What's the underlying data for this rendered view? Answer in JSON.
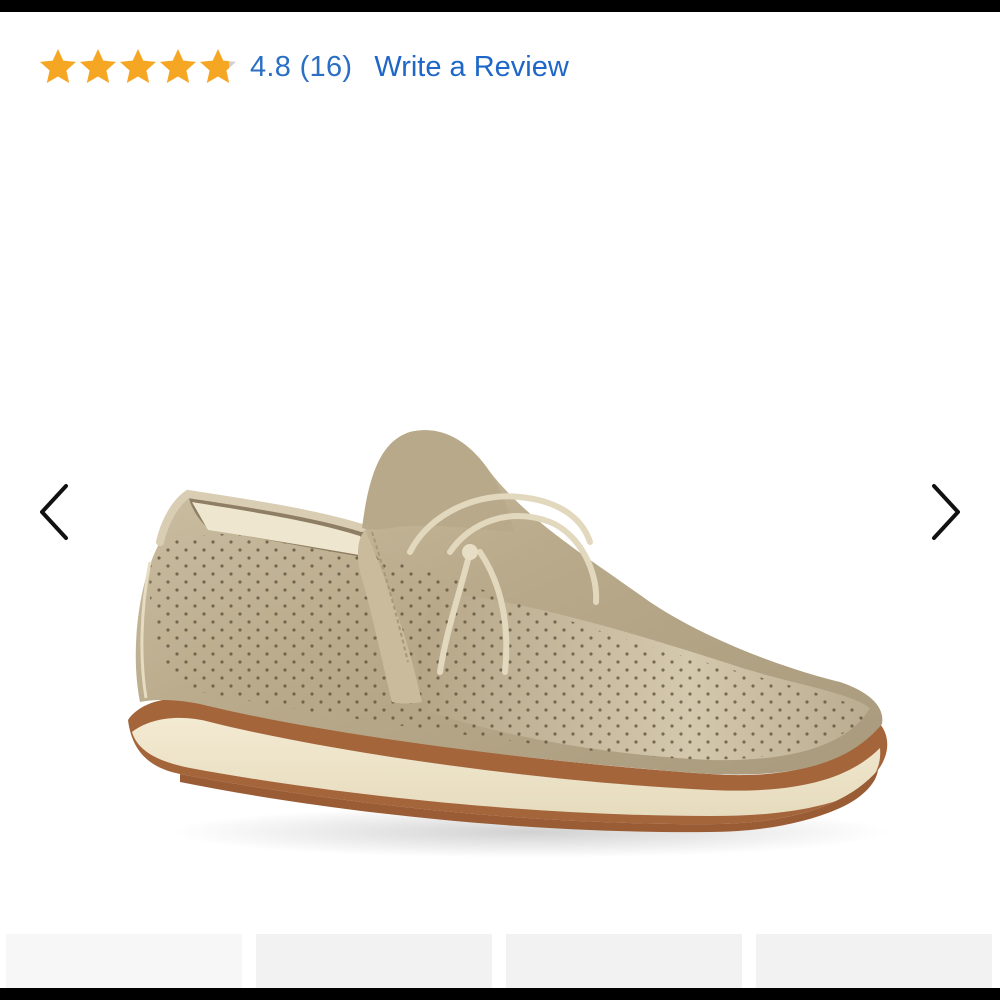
{
  "rating": {
    "value": 4.8,
    "value_text": "4.8 (16)",
    "stars_filled": 4.8,
    "stars_max": 5,
    "star_color": "#f5a623",
    "star_empty_color": "#d0d0d0",
    "link_color": "#1e66c8"
  },
  "review_link": {
    "label": "Write a Review"
  },
  "carousel": {
    "prev_icon": "chevron-left-icon",
    "next_icon": "chevron-right-icon",
    "product_image": "shoe-image",
    "thumbnail_count": 4
  }
}
